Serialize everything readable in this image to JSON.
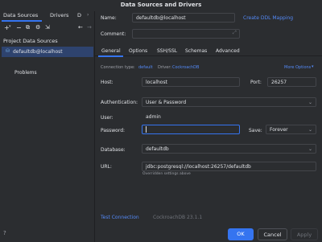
{
  "window": {
    "title": "Data Sources and Drivers"
  },
  "left_tabs": [
    "Data Sources",
    "Drivers",
    "D"
  ],
  "toolbar_icons": [
    "add-icon",
    "remove-icon",
    "duplicate-icon",
    "settings-icon",
    "import-icon",
    "back-icon"
  ],
  "left": {
    "section_title": "Project Data Sources",
    "selected_item": "defaultdb@localhost",
    "problems_label": "Problems"
  },
  "form": {
    "name_label": "Name:",
    "name_value": "defaultdb@localhost",
    "create_ddl_link": "Create DDL Mapping",
    "comment_label": "Comment:",
    "tabs": [
      "General",
      "Options",
      "SSH/SSL",
      "Schemas",
      "Advanced"
    ],
    "active_tab": "General",
    "connection_type_label": "Connection type:",
    "connection_type_value": "default",
    "driver_label": "Driver:",
    "driver_value": "CockroachDB",
    "more_options": "More Options",
    "host_label": "Host:",
    "host_value": "localhost",
    "port_label": "Port:",
    "port_value": "26257",
    "auth_label": "Authentication:",
    "auth_value": "User & Password",
    "user_label": "User:",
    "user_value": "admin",
    "password_label": "Password:",
    "password_placeholder": "",
    "save_label": "Save:",
    "save_value": "Forever",
    "database_label": "Database:",
    "database_value": "defaultdb",
    "url_label": "URL:",
    "url_value": "jdbc:postgresql://localhost:26257/defaultdb",
    "url_hint": "Overridden settings above"
  },
  "footer": {
    "test_connection": "Test Connection",
    "driver_version": "CockroachDB 23.1.1",
    "ok": "OK",
    "cancel": "Cancel",
    "apply": "Apply"
  },
  "colors": {
    "accent": "#3574f0",
    "link": "#548af7",
    "background": "#2b2d30",
    "selection": "#2e436e"
  }
}
